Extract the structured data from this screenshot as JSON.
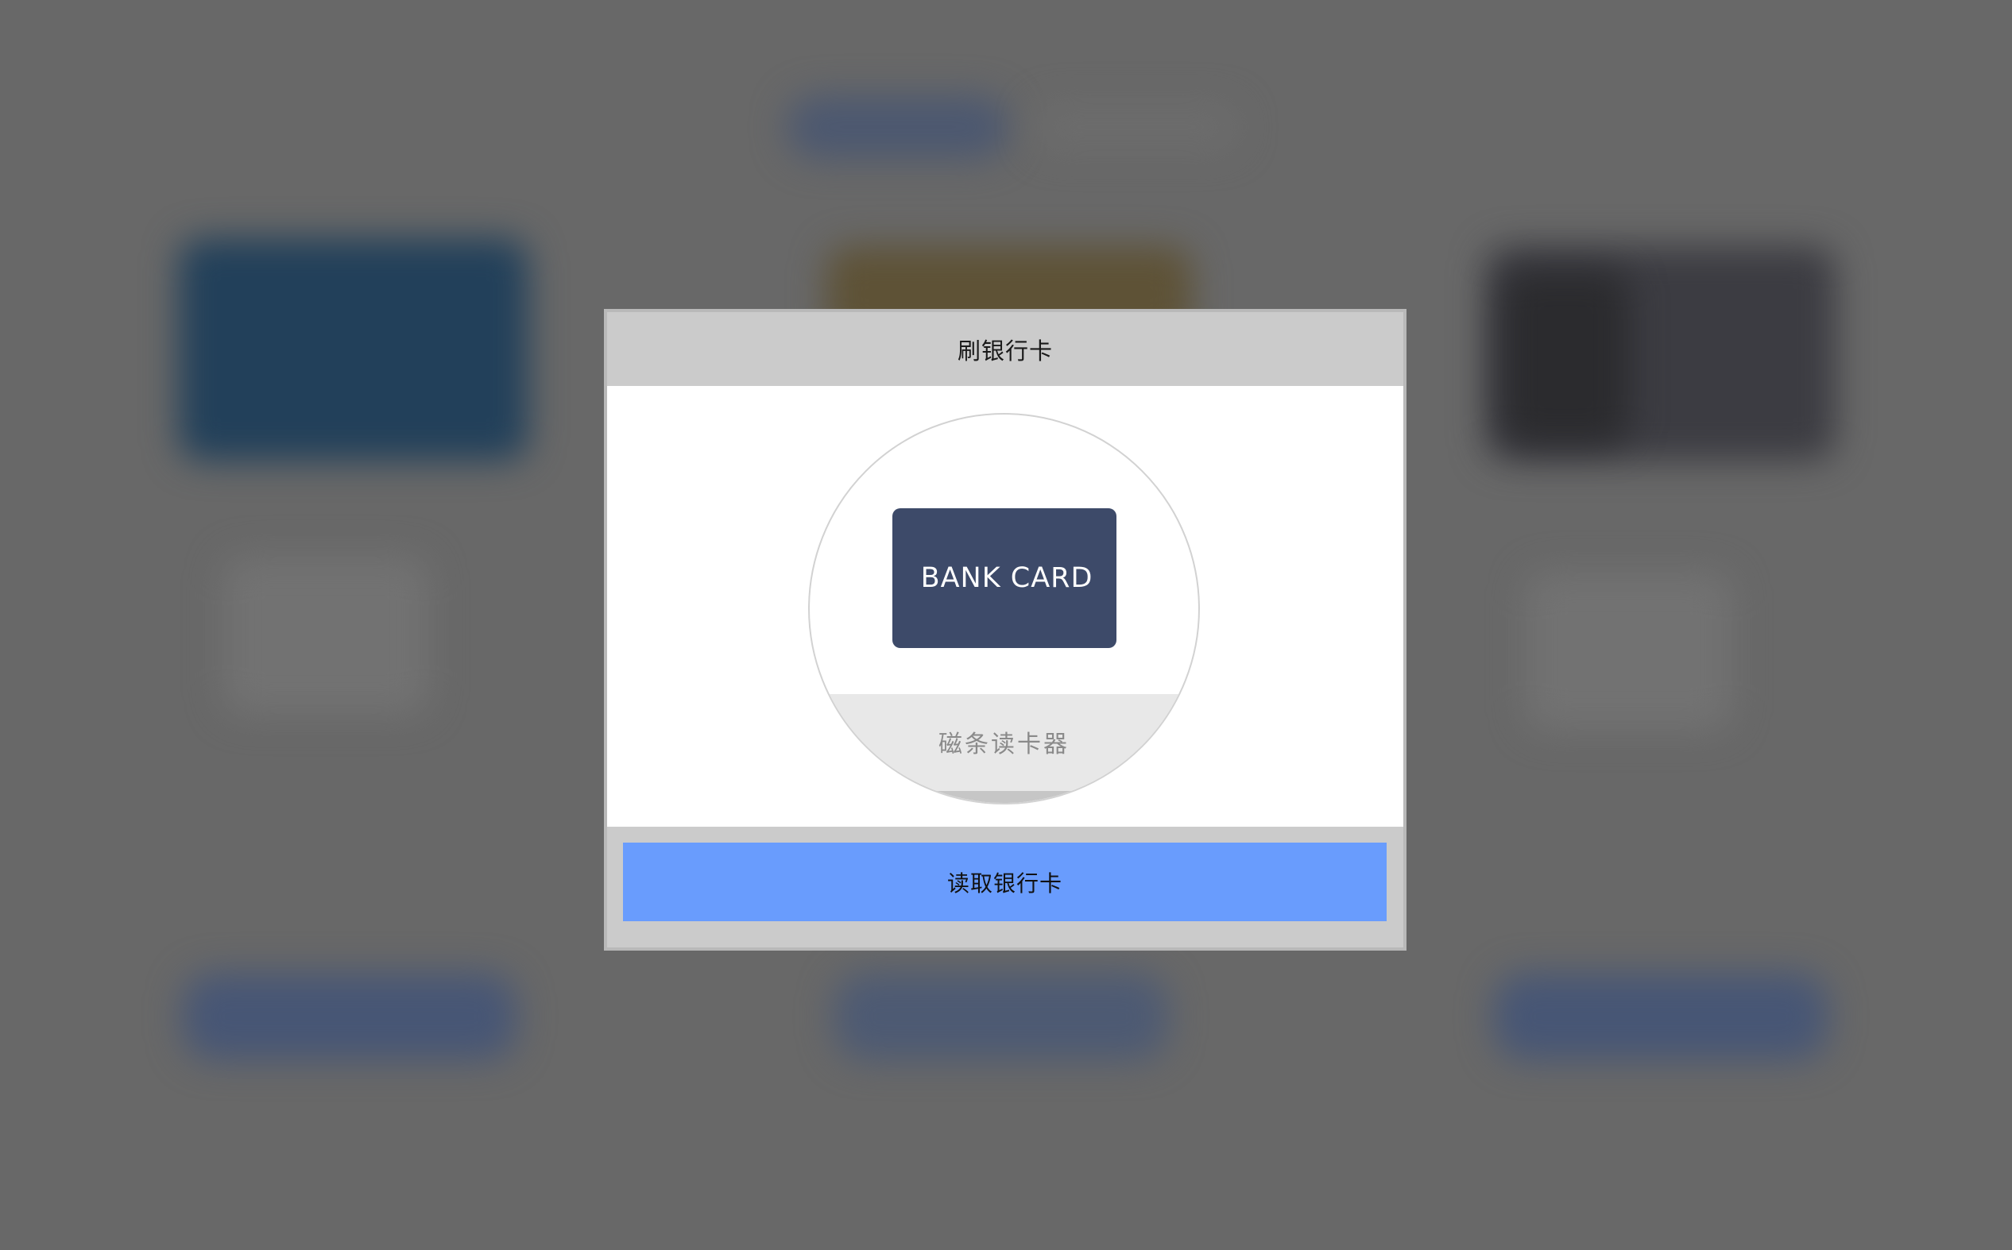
{
  "dialog": {
    "title": "刷银行卡",
    "card_label": "BANK CARD",
    "reader_label": "磁条读卡器",
    "confirm_label": "读取银行卡"
  },
  "colors": {
    "backdrop": "#686868",
    "header": "#cbcbcb",
    "card": "#3d4a69",
    "reader_slot": "#e8e8e8",
    "button": "#699cfd"
  },
  "icons": {
    "card_reader": "card-reader-illustration"
  }
}
